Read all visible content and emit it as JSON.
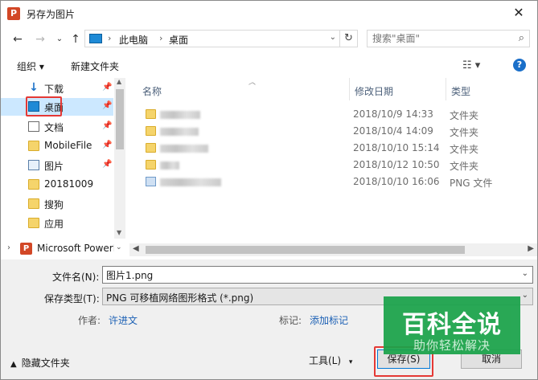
{
  "window": {
    "title": "另存为图片",
    "app_icon": "P"
  },
  "address": {
    "crumbs": [
      "此电脑",
      "桌面"
    ]
  },
  "search": {
    "placeholder": "搜索\"桌面\""
  },
  "toolbar": {
    "organize": "组织 ▾",
    "new_folder": "新建文件夹"
  },
  "nav": {
    "items": [
      {
        "label": "下载",
        "icon": "download-icon",
        "pinned": true
      },
      {
        "label": "桌面",
        "icon": "desktop-icon",
        "pinned": true,
        "selected": true
      },
      {
        "label": "文档",
        "icon": "document-icon",
        "pinned": true
      },
      {
        "label": "MobileFile",
        "icon": "folder-icon",
        "pinned": true
      },
      {
        "label": "图片",
        "icon": "picture-icon",
        "pinned": true
      },
      {
        "label": "20181009",
        "icon": "folder-icon"
      },
      {
        "label": "搜狗",
        "icon": "folder-icon"
      },
      {
        "label": "应用",
        "icon": "folder-icon"
      }
    ],
    "ppt_label": "Microsoft PowerPoint"
  },
  "columns": {
    "name": "名称",
    "date": "修改日期",
    "type": "类型"
  },
  "files": [
    {
      "date": "2018/10/9 14:33",
      "type": "文件夹",
      "icon": "folder-icon"
    },
    {
      "date": "2018/10/4 14:09",
      "type": "文件夹",
      "icon": "folder-icon"
    },
    {
      "date": "2018/10/10 15:14",
      "type": "文件夹",
      "icon": "folder-icon"
    },
    {
      "date": "2018/10/12 10:50",
      "type": "文件夹",
      "icon": "folder-icon"
    },
    {
      "date": "2018/10/10 16:06",
      "type": "PNG 文件",
      "icon": "png-file-icon"
    }
  ],
  "form": {
    "filename_label": "文件名(N):",
    "filename_value": "图片1.png",
    "filetype_label": "保存类型(T):",
    "filetype_value": "PNG 可移植网络图形格式 (*.png)",
    "author_label": "作者:",
    "author_value": "许进文",
    "tags_label": "标记:",
    "tags_value": "添加标记"
  },
  "footer": {
    "hide_folders": "隐藏文件夹",
    "tools": "工具(L)",
    "save": "保存(S)",
    "cancel": "取消"
  },
  "watermark": {
    "title": "百科全说",
    "subtitle": "助你轻松解决"
  }
}
